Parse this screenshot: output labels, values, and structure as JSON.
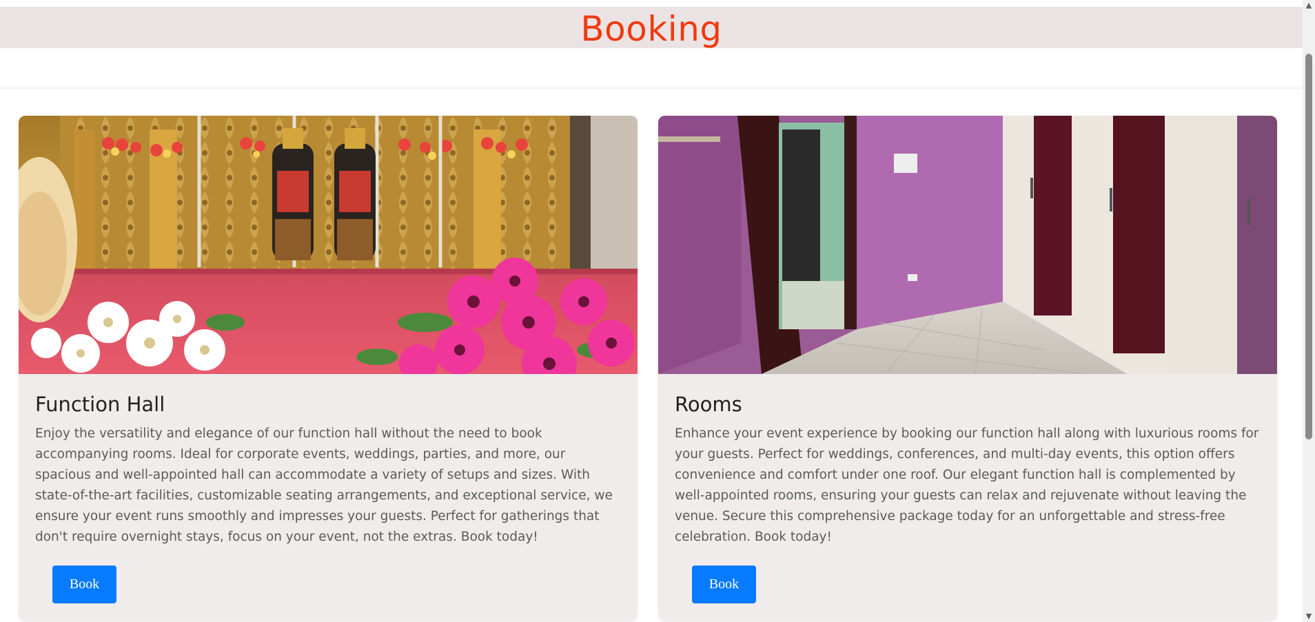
{
  "header": {
    "title": "Booking"
  },
  "cards": [
    {
      "title": "Function Hall",
      "description": "Enjoy the versatility and elegance of our function hall without the need to book accompanying rooms. Ideal for corporate events, weddings, parties, and more, our spacious and well-appointed hall can accommodate a variety of setups and sizes. With state-of-the-art facilities, customizable seating arrangements, and exceptional service, we ensure your event runs smoothly and impresses your guests. Perfect for gatherings that don't require overnight stays, focus on your event, not the extras. Book today!",
      "button_label": "Book"
    },
    {
      "title": "Rooms",
      "description": "Enhance your event experience by booking our function hall along with luxurious rooms for your guests. Perfect for weddings, conferences, and multi-day events, this option offers convenience and comfort under one roof. Our elegant function hall is complemented by well-appointed rooms, ensuring your guests can relax and rejuvenate without leaving the venue. Secure this comprehensive package today for an unforgettable and stress-free celebration. Book today!",
      "button_label": "Book"
    }
  ],
  "colors": {
    "accent": "#ef3a0e",
    "header_bg": "#ebe3e3",
    "card_bg": "#f0ecec",
    "button_bg": "#077bff"
  },
  "icons": {
    "scroll_up": "scroll-up-arrow-icon",
    "scroll_down": "scroll-down-arrow-icon"
  }
}
